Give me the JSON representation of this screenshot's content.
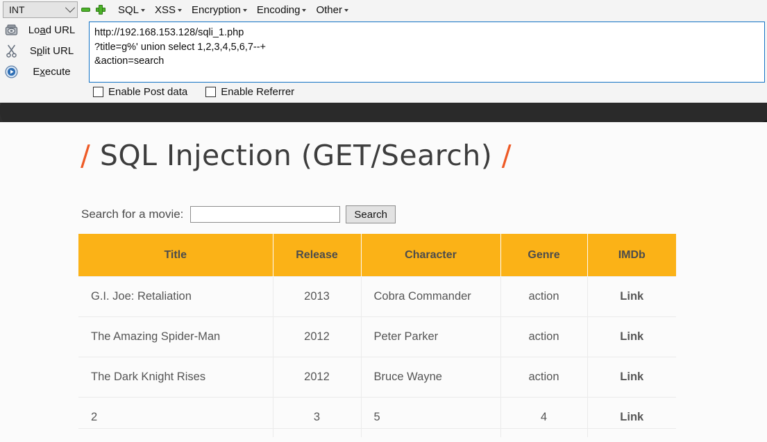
{
  "hackbar": {
    "type_select": {
      "value": "INT",
      "icon": "chevron-down-icon"
    },
    "remove_icon": "minus-icon",
    "add_icon": "plus-icon",
    "menus": [
      {
        "label": "SQL",
        "caret": "caret-down-icon"
      },
      {
        "label": "XSS",
        "caret": "caret-down-icon"
      },
      {
        "label": "Encryption",
        "caret": "caret-down-icon"
      },
      {
        "label": "Encoding",
        "caret": "caret-down-icon"
      },
      {
        "label": "Other",
        "caret": "caret-down-icon"
      }
    ],
    "actions": [
      {
        "label_pre": "Lo",
        "label_key": "a",
        "label_post": "d URL",
        "icon": "load-url-icon"
      },
      {
        "label_pre": "S",
        "label_key": "p",
        "label_post": "lit URL",
        "icon": "scissors-icon"
      },
      {
        "label_pre": "E",
        "label_key": "x",
        "label_post": "ecute",
        "icon": "play-icon"
      }
    ],
    "url_value": "http://192.168.153.128/sqli_1.php\n?title=g%' union select 1,2,3,4,5,6,7--+\n&action=search",
    "checkboxes": [
      {
        "label": "Enable Post data",
        "checked": false
      },
      {
        "label": "Enable Referrer",
        "checked": false
      }
    ]
  },
  "page": {
    "title_slash_left": "/",
    "title_text": "SQL Injection (GET/Search)",
    "title_slash_right": "/",
    "search": {
      "label": "Search for a movie:",
      "input_value": "",
      "input_placeholder": "",
      "button_label": "Search"
    },
    "table": {
      "headers": [
        "Title",
        "Release",
        "Character",
        "Genre",
        "IMDb"
      ],
      "rows": [
        {
          "title": "G.I. Joe: Retaliation",
          "release": "2013",
          "character": "Cobra Commander",
          "genre": "action",
          "imdb": "Link"
        },
        {
          "title": "The Amazing Spider-Man",
          "release": "2012",
          "character": "Peter Parker",
          "genre": "action",
          "imdb": "Link"
        },
        {
          "title": "The Dark Knight Rises",
          "release": "2012",
          "character": "Bruce Wayne",
          "genre": "action",
          "imdb": "Link"
        },
        {
          "title": "2",
          "release": "3",
          "character": "5",
          "genre": "4",
          "imdb": "Link"
        }
      ]
    }
  },
  "colors": {
    "table_header": "#fbb217",
    "accent_orange": "#ee5a26",
    "dark_band": "#2a2a2a",
    "textarea_border": "#1272c4",
    "icon_green": "#4db32a"
  }
}
